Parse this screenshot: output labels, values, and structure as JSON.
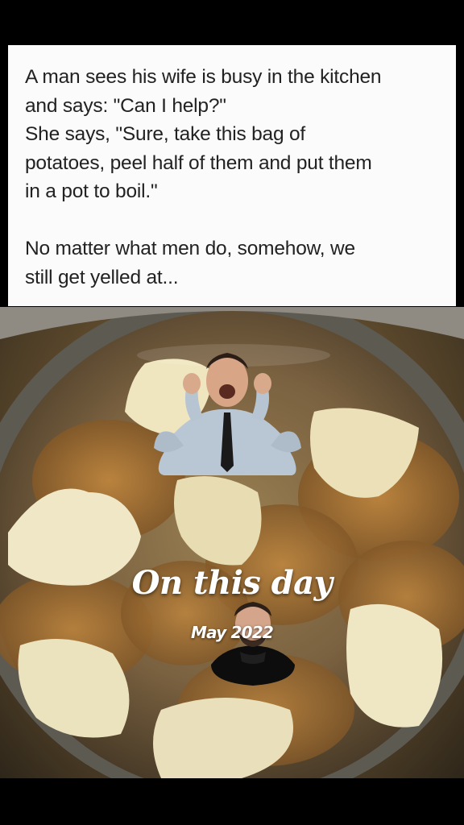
{
  "meme": {
    "paragraph1": [
      "A man sees his wife is busy in the kitchen",
      "and says: \"Can I help?\"",
      "She says, \"Sure, take this bag of",
      "potatoes, peel half of them and put them",
      "in a pot to boil.\""
    ],
    "paragraph2": [
      "No matter what men do, somehow, we",
      "still get yelled at..."
    ]
  },
  "photo": {
    "subject": "pot of half-peeled potatoes boiling in water"
  },
  "overlay": {
    "title": "On this day",
    "date": "May 2022"
  },
  "icons": {
    "sticker": "cheering-man-sticker",
    "avatar": "profile-avatar"
  }
}
